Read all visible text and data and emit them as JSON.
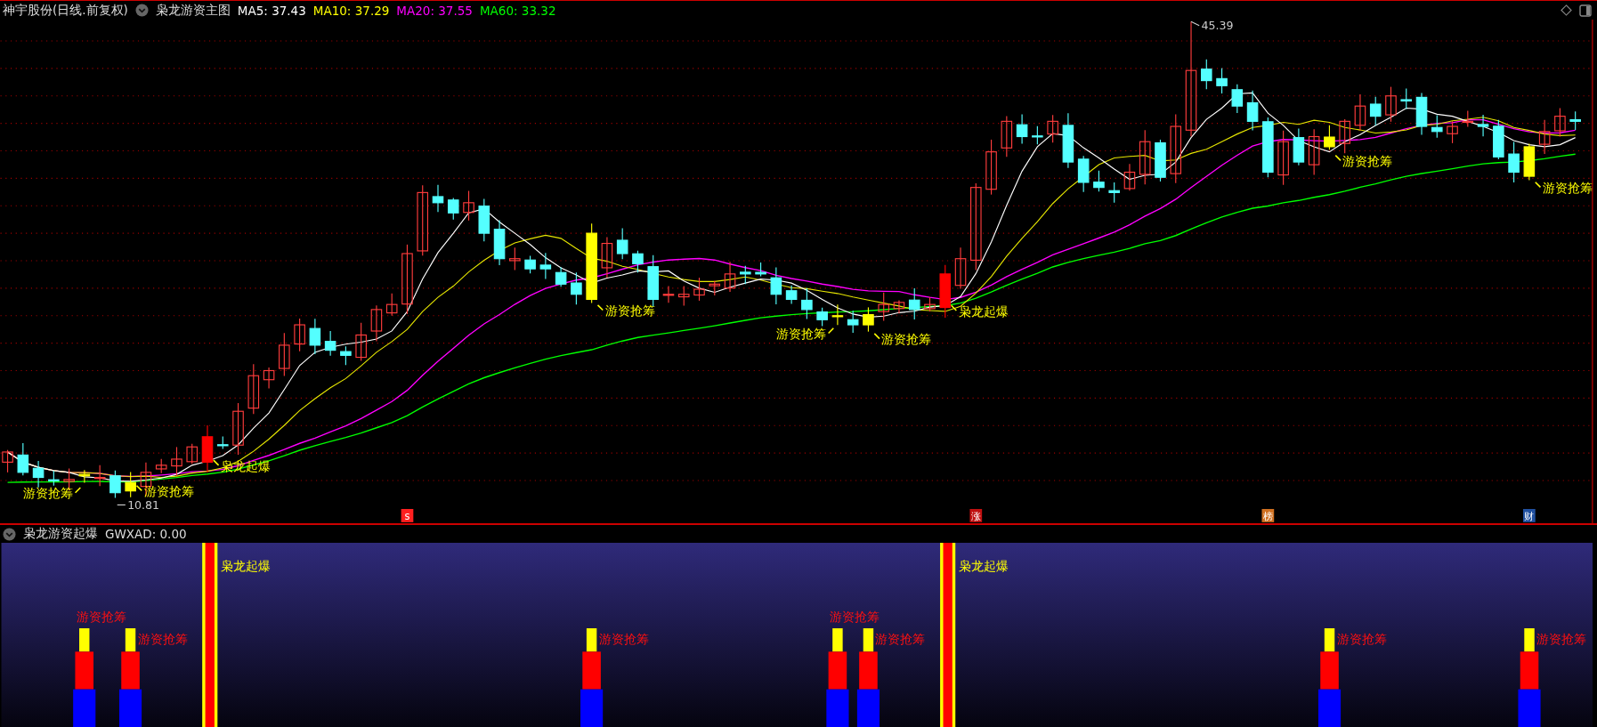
{
  "header": {
    "stock_title": "神宇股份(日线.前复权)",
    "indicator_name": "枭龙游资主图",
    "ma_values": [
      {
        "label": "MA5: 37.43",
        "color": "#ffffff"
      },
      {
        "label": "MA10: 37.29",
        "color": "#ffff00"
      },
      {
        "label": "MA20: 37.55",
        "color": "#ff00ff"
      },
      {
        "label": "MA60: 33.32",
        "color": "#00ff00"
      }
    ]
  },
  "main_chart": {
    "high_label": "45.39",
    "low_label": "10.81",
    "signals": [
      {
        "kind": "grab",
        "label": "游资抢筹"
      },
      {
        "kind": "grab",
        "label": "游资抢筹"
      },
      {
        "kind": "explode",
        "label": "枭龙起爆"
      },
      {
        "kind": "grab",
        "label": "游资抢筹"
      },
      {
        "kind": "grab",
        "label": "游资抢筹"
      },
      {
        "kind": "grab",
        "label": "游资抢筹"
      },
      {
        "kind": "explode",
        "label": "枭龙起爆"
      },
      {
        "kind": "grab",
        "label": "游资抢筹"
      },
      {
        "kind": "grab",
        "label": "游资抢筹"
      }
    ],
    "markers": [
      {
        "label": "s",
        "color": "#ff2020"
      },
      {
        "label": "涨",
        "color": "#c01010"
      },
      {
        "label": "榜",
        "color": "#d07020"
      },
      {
        "label": "财",
        "color": "#2050a0"
      }
    ]
  },
  "indicator_panel": {
    "title": "枭龙游资起爆",
    "reading": "GWXAD: 0.00",
    "signals": [
      {
        "kind": "grab",
        "label": "游资抢筹"
      },
      {
        "kind": "grab",
        "label": "游资抢筹"
      },
      {
        "kind": "explode",
        "label": "枭龙起爆"
      },
      {
        "kind": "grab",
        "label": "游资抢筹"
      },
      {
        "kind": "grab",
        "label": "游资抢筹"
      },
      {
        "kind": "grab",
        "label": "游资抢筹"
      },
      {
        "kind": "explode",
        "label": "枭龙起爆"
      },
      {
        "kind": "grab",
        "label": "游资抢筹"
      },
      {
        "kind": "grab",
        "label": "游资抢筹"
      }
    ]
  }
}
